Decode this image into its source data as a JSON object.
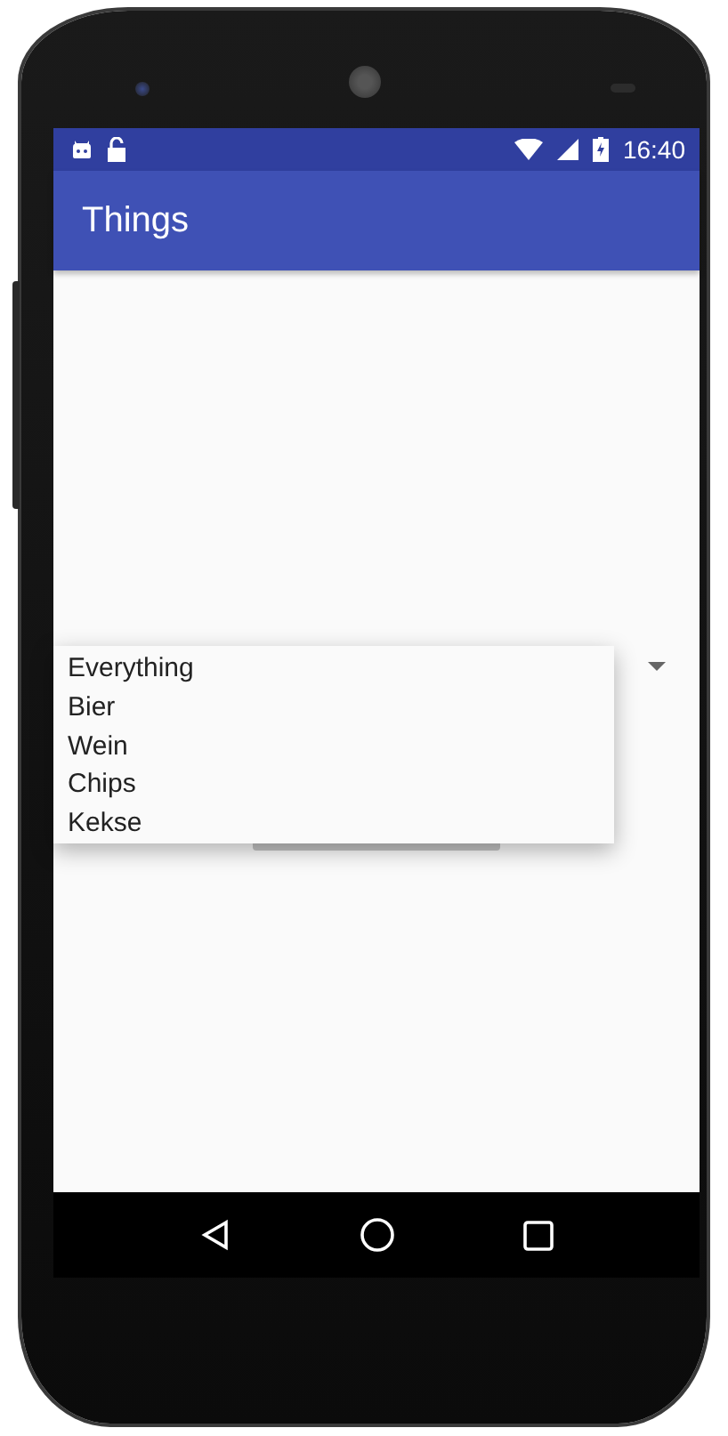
{
  "status_bar": {
    "time": "16:40"
  },
  "app_bar": {
    "title": "Things"
  },
  "spinner": {
    "expanded": true,
    "options": [
      {
        "label": "Everything"
      },
      {
        "label": "Bier"
      },
      {
        "label": "Wein"
      },
      {
        "label": "Chips"
      },
      {
        "label": "Kekse"
      }
    ]
  }
}
